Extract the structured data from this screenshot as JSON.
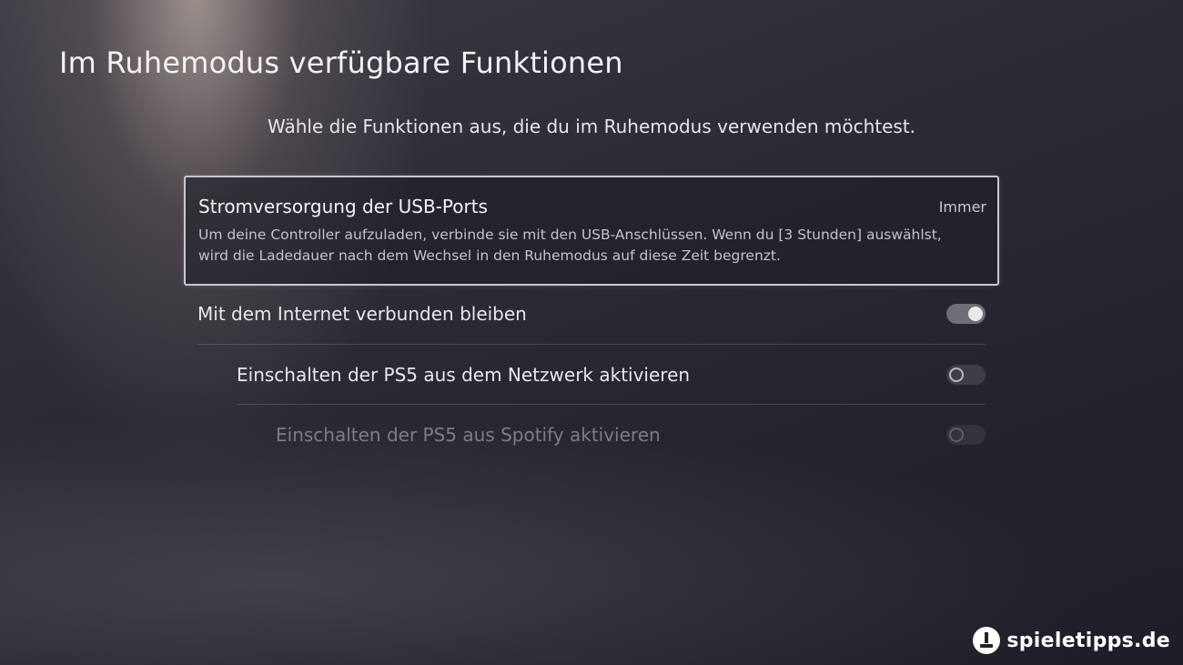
{
  "header": {
    "title": "Im Ruhemodus verfügbare Funktionen",
    "subtitle": "Wähle die Funktionen aus, die du im Ruhemodus verwenden möchtest."
  },
  "usb_power": {
    "title": "Stromversorgung der USB-Ports",
    "value": "Immer",
    "description": "Um deine Controller aufzuladen, verbinde sie mit den USB-Anschlüssen. Wenn du [3 Stunden] auswählst, wird die Ladedauer nach dem Wechsel in den Ruhemodus auf diese Zeit begrenzt."
  },
  "settings": [
    {
      "label": "Mit dem Internet verbunden bleiben",
      "enabled": true,
      "state": "on"
    },
    {
      "label": "Einschalten der PS5 aus dem Netzwerk aktivieren",
      "enabled": true,
      "state": "off"
    },
    {
      "label": "Einschalten der PS5 aus Spotify aktivieren",
      "enabled": false,
      "state": "off"
    }
  ],
  "watermark": {
    "text": "spieletipps.de",
    "icon": "spieletipps-logo-icon"
  },
  "colors": {
    "focus_border": "#c8c8d0",
    "toggle_on": "#6e6e76",
    "disabled_text": "#7d7d85"
  }
}
